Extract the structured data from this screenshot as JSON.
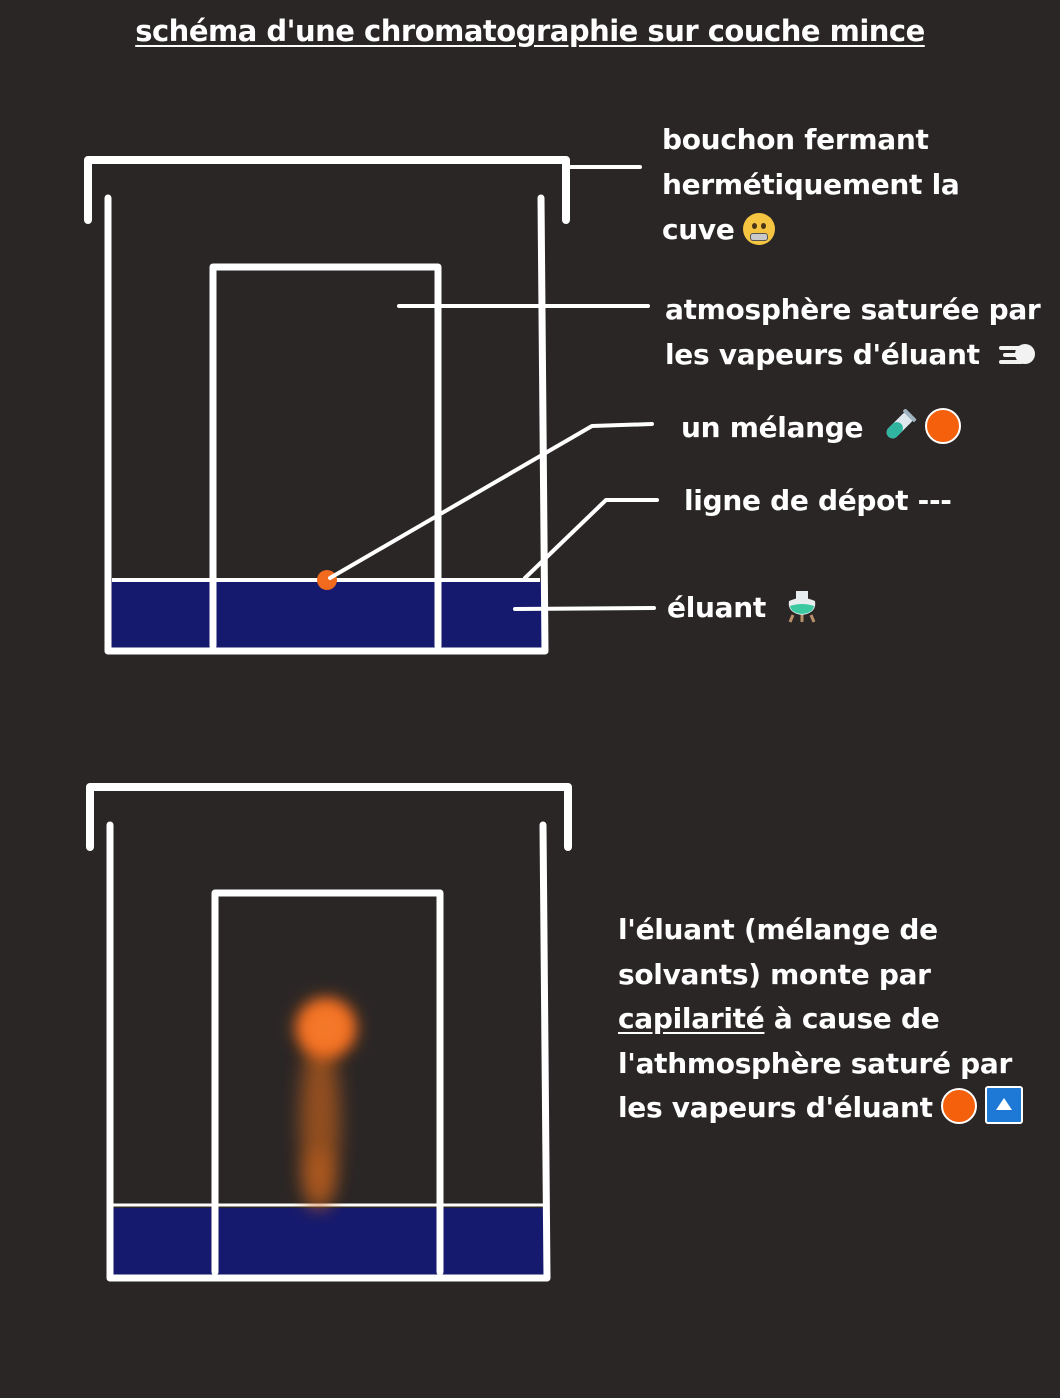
{
  "title": "schéma d'une chromatographie sur couche mince",
  "labels": {
    "bouchon_line1": "bouchon fermant",
    "bouchon_line2": "hermétiquement la",
    "bouchon_line3": "cuve",
    "atmosphere_line1": "atmosphère saturée par",
    "atmosphere_line2": "les vapeurs d'éluant",
    "melange": "un mélange",
    "ligne": "ligne de dépot ---",
    "eluant": "éluant"
  },
  "explanation": {
    "line1": "l'éluant (mélange de",
    "line2": "solvants) monte par",
    "line3_link": "capilarité",
    "line3_rest": "à cause de",
    "line4": "l'athmosphère saturé par",
    "line5": "les vapeurs d'éluant"
  },
  "icons": {
    "bouchon": "zipper-mouth-face-icon",
    "atmosphere": "dash-wind-icon",
    "melange_tube": "test-tube-icon",
    "melange_dot": "orange-circle-icon",
    "eluant": "flask-icon",
    "explanation_circle": "orange-circle-icon",
    "explanation_triangle": "up-triangle-button-icon"
  },
  "colors": {
    "background": "#2b2626",
    "stroke": "#ffffff",
    "eluant": "#161a6e",
    "spot": "#f26a1e"
  }
}
